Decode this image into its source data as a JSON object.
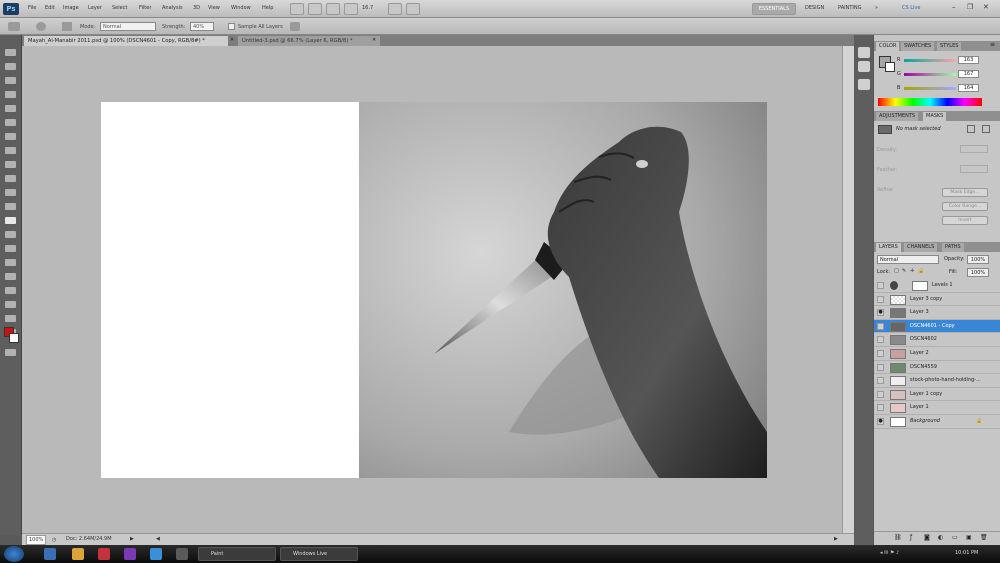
{
  "menubar": {
    "logo": "Ps",
    "items": [
      "File",
      "Edit",
      "Image",
      "Layer",
      "Select",
      "Filter",
      "Analysis",
      "3D",
      "View",
      "Window",
      "Help"
    ],
    "zoom": "16.7",
    "workspace": "ESSENTIALS",
    "design": "DESIGN",
    "painting": "PAINTING",
    "cslive": "CS Live"
  },
  "options": {
    "mode_label": "Mode:",
    "mode_value": "Normal",
    "strength_label": "Strength:",
    "strength_value": "40%",
    "sample_label": "Sample All Layers"
  },
  "document": {
    "tabs": [
      {
        "label": "Mayah_Al-Manabir 2011.psd @ 100% (DSCN4601 - Copy, RGB/8#) *",
        "close": "✕"
      },
      {
        "label": "Untitled-3.psd @ 66.7% (Layer 6, RGB/8) *",
        "close": "✕"
      }
    ],
    "zoom": "100%",
    "doc_info": "Doc: 2.64M/24.9M"
  },
  "color_panel": {
    "tabs": [
      "COLOR",
      "SWATCHES",
      "STYLES"
    ],
    "channels": [
      {
        "label": "R",
        "value": "163"
      },
      {
        "label": "G",
        "value": "167"
      },
      {
        "label": "B",
        "value": "164"
      }
    ]
  },
  "masks_panel": {
    "tabs": [
      "ADJUSTMENTS",
      "MASKS"
    ],
    "status": "No mask selected",
    "density_label": "Density:",
    "feather_label": "Feather:",
    "refine_label": "Refine:",
    "buttons": [
      "Mask Edge...",
      "Color Range...",
      "Invert"
    ]
  },
  "layers_panel": {
    "tabs": [
      "LAYERS",
      "CHANNELS",
      "PATHS"
    ],
    "blend_mode": "Normal",
    "opacity_label": "Opacity:",
    "opacity_value": "100%",
    "lock_label": "Lock:",
    "fill_label": "Fill:",
    "fill_value": "100%",
    "layers": [
      {
        "name": "Levels 1",
        "visible": false,
        "selected": false
      },
      {
        "name": "Layer 3 copy",
        "visible": false,
        "selected": false
      },
      {
        "name": "Layer 3",
        "visible": true,
        "selected": false
      },
      {
        "name": "DSCN4601 - Copy",
        "visible": false,
        "selected": true
      },
      {
        "name": "DSCN4602",
        "visible": false,
        "selected": false
      },
      {
        "name": "Layer 2",
        "visible": false,
        "selected": false
      },
      {
        "name": "DSCN4559",
        "visible": false,
        "selected": false
      },
      {
        "name": "stock-photo-hand-holding-...",
        "visible": false,
        "selected": false
      },
      {
        "name": "Layer 1 copy",
        "visible": false,
        "selected": false
      },
      {
        "name": "Layer 1",
        "visible": false,
        "selected": false
      },
      {
        "name": "Background",
        "visible": true,
        "selected": false
      }
    ]
  },
  "taskbar": {
    "buttons": [
      "Paint",
      "Windows Live"
    ],
    "clock": "10:01 PM"
  },
  "colors": {
    "accent": "#3a86d6",
    "foreground_color": "#cc1111"
  }
}
